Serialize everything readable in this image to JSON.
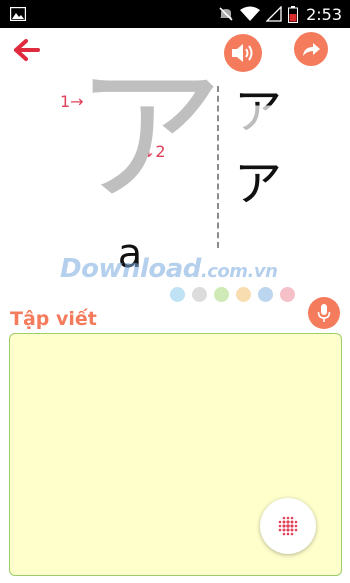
{
  "status_bar": {
    "time": "2:53",
    "icons": [
      "image-icon",
      "mute-icon",
      "wifi-icon",
      "signal-icon",
      "battery-icon"
    ]
  },
  "toolbar": {
    "back_icon": "arrow-left-icon",
    "sound_icon": "speaker-icon",
    "share_icon": "share-arrow-icon"
  },
  "lesson": {
    "character": "ア",
    "romaji": "a",
    "stroke_1_label": "1→",
    "stroke_2_label": "↓2",
    "stroke_steps": [
      "ア",
      "ア"
    ]
  },
  "watermark": {
    "text": "Download",
    "suffix": ".com.vn"
  },
  "color_dots": [
    "#bfe2f5",
    "#dcdcdc",
    "#cfe9b7",
    "#f8ddb0",
    "#bcd6f0",
    "#f5c0c8"
  ],
  "practice": {
    "label": "Tập viết",
    "mic_icon": "microphone-icon",
    "action_icon": "recognize-icon"
  },
  "colors": {
    "accent": "#f47c5d",
    "red": "#e0405a",
    "pad_bg": "#ffffcc",
    "pad_border": "#9bcf6a"
  }
}
